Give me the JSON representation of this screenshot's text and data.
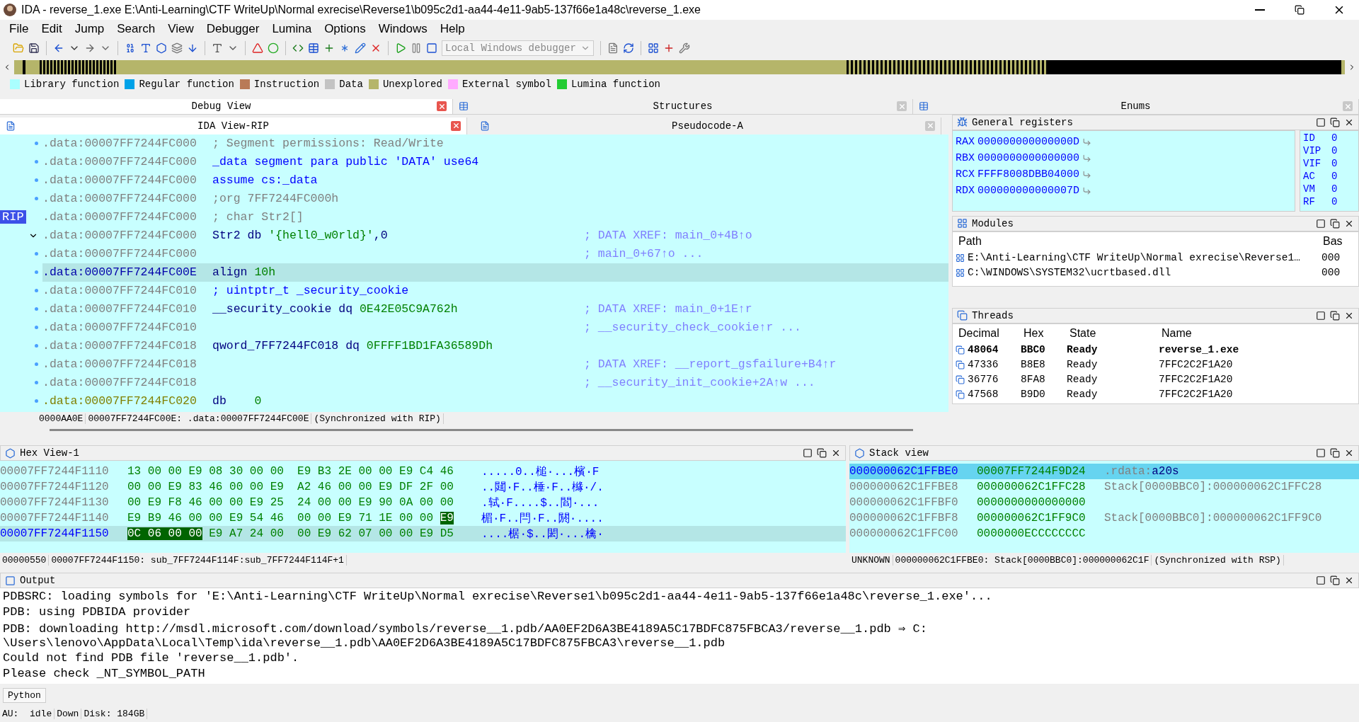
{
  "window": {
    "title": "IDA - reverse_1.exe E:\\Anti-Learning\\CTF WriteUp\\Normal exrecise\\Reverse1\\b095c2d1-aa44-4e11-9ab5-137f66e1a48c\\reverse_1.exe"
  },
  "menu": [
    "File",
    "Edit",
    "Jump",
    "Search",
    "View",
    "Debugger",
    "Lumina",
    "Options",
    "Windows",
    "Help"
  ],
  "toolbar": {
    "debugger": "Local Windows debugger",
    "debugger_disabled": true
  },
  "legend": [
    {
      "label": "Library function",
      "color": "#aaffff"
    },
    {
      "label": "Regular function",
      "color": "#00a2e8"
    },
    {
      "label": "Instruction",
      "color": "#b97a57"
    },
    {
      "label": "Data",
      "color": "#c3c3c3"
    },
    {
      "label": "Unexplored",
      "color": "#b5b56a"
    },
    {
      "label": "External symbol",
      "color": "#ffaaff"
    },
    {
      "label": "Lumina function",
      "color": "#22cc33"
    }
  ],
  "top_tabs": [
    {
      "label": "Debug View",
      "selected": true
    },
    {
      "label": "Structures",
      "selected": false
    },
    {
      "label": "Enums",
      "selected": false
    }
  ],
  "view_tabs": [
    {
      "label": "IDA View-RIP",
      "selected": true
    },
    {
      "label": "Pseudocode-A",
      "selected": false
    }
  ],
  "disasm": {
    "lines": [
      {
        "addr": ".data:00007FF7244FC000",
        "kind": "data",
        "selected": false,
        "tokens": [
          {
            "kind": "grey",
            "text": "; Segment permissions: Read/Write"
          }
        ]
      },
      {
        "addr": ".data:00007FF7244FC000",
        "kind": "data",
        "selected": false,
        "tokens": [
          {
            "kind": "keyword",
            "text": "_data segment para public 'DATA' use64"
          }
        ]
      },
      {
        "addr": ".data:00007FF7244FC000",
        "kind": "data",
        "selected": false,
        "tokens": [
          {
            "kind": "keyword",
            "text": "assume cs:_data"
          }
        ]
      },
      {
        "addr": ".data:00007FF7244FC000",
        "kind": "data",
        "selected": false,
        "tokens": [
          {
            "kind": "grey",
            "text": ";org 7FF7244FC000h"
          }
        ]
      },
      {
        "addr": ".data:00007FF7244FC000",
        "kind": "data",
        "selected": false,
        "marker": "RIP",
        "tokens": [
          {
            "kind": "grey",
            "text": "; char Str2[]"
          }
        ]
      },
      {
        "addr": ".data:00007FF7244FC000",
        "kind": "data",
        "selected": false,
        "expanded": true,
        "tokens": [
          {
            "kind": "name",
            "text": "Str2 db "
          },
          {
            "kind": "number",
            "text": "'{hell0_w0rld}'"
          },
          {
            "kind": "name",
            "text": ",0"
          }
        ],
        "comment": "; DATA XREF: main_0+4B↑o"
      },
      {
        "addr": ".data:00007FF7244FC000",
        "kind": "data",
        "selected": false,
        "comment": "; main_0+67↑o ..."
      },
      {
        "addr": ".data:00007FF7244FC00E",
        "kind": "data",
        "selected": true,
        "tokens": [
          {
            "kind": "name",
            "text": "align "
          },
          {
            "kind": "number",
            "text": "10h"
          }
        ]
      },
      {
        "addr": ".data:00007FF7244FC010",
        "kind": "data",
        "selected": false,
        "tokens": [
          {
            "kind": "keyword",
            "text": "; uintptr_t _security_cookie"
          }
        ]
      },
      {
        "addr": ".data:00007FF7244FC010",
        "kind": "data",
        "selected": false,
        "tokens": [
          {
            "kind": "name",
            "text": "__security_cookie dq "
          },
          {
            "kind": "number",
            "text": "0E42E05C9A762h"
          }
        ],
        "comment": "; DATA XREF: main_0+1E↑r"
      },
      {
        "addr": ".data:00007FF7244FC010",
        "kind": "data",
        "selected": false,
        "comment": "; __security_check_cookie↑r ..."
      },
      {
        "addr": ".data:00007FF7244FC018",
        "kind": "data",
        "selected": false,
        "tokens": [
          {
            "kind": "name",
            "text": "qword_7FF7244FC018 dq "
          },
          {
            "kind": "number",
            "text": "0FFFF1BD1FA36589Dh"
          }
        ]
      },
      {
        "addr": ".data:00007FF7244FC018",
        "kind": "data",
        "selected": false,
        "comment": "; DATA XREF: __report_gsfailure+B4↑r"
      },
      {
        "addr": ".data:00007FF7244FC018",
        "kind": "data",
        "selected": false,
        "comment": "; __security_init_cookie+2A↑w ..."
      },
      {
        "addr": ".data:00007FF7244FC020",
        "kind": "unexplored",
        "selected": false,
        "tokens": [
          {
            "kind": "name",
            "text": "db    "
          },
          {
            "kind": "number",
            "text": "0"
          }
        ]
      }
    ],
    "status": [
      "0000AA0E",
      "00007FF7244FC00E: .data:00007FF7244FC00E",
      "(Synchronized with RIP)"
    ]
  },
  "registers": {
    "title": "General registers",
    "rows": [
      {
        "name": "RAX",
        "value": "000000000000000D"
      },
      {
        "name": "RBX",
        "value": "0000000000000000"
      },
      {
        "name": "RCX",
        "value": "FFFF8008DBB04000"
      },
      {
        "name": "RDX",
        "value": "000000000000007D"
      }
    ],
    "flags": [
      {
        "name": "ID",
        "value": "0"
      },
      {
        "name": "VIP",
        "value": "0"
      },
      {
        "name": "VIF",
        "value": "0"
      },
      {
        "name": "AC",
        "value": "0"
      },
      {
        "name": "VM",
        "value": "0"
      },
      {
        "name": "RF",
        "value": "0"
      }
    ]
  },
  "modules": {
    "title": "Modules",
    "columns": [
      "Path",
      "Bas"
    ],
    "rows": [
      {
        "path": "E:\\Anti-Learning\\CTF WriteUp\\Normal exrecise\\Reverse1…",
        "base": "000"
      },
      {
        "path": "C:\\WINDOWS\\SYSTEM32\\ucrtbased.dll",
        "base": "000"
      }
    ]
  },
  "threads": {
    "title": "Threads",
    "columns": [
      "Decimal",
      "Hex",
      "State",
      "Name"
    ],
    "rows": [
      {
        "decimal": "48064",
        "hex": "BBC0",
        "state": "Ready",
        "name": "reverse_1.exe",
        "selected": true
      },
      {
        "decimal": "47336",
        "hex": "B8E8",
        "state": "Ready",
        "name": "7FFC2C2F1A20",
        "selected": false
      },
      {
        "decimal": "36776",
        "hex": "8FA8",
        "state": "Ready",
        "name": "7FFC2C2F1A20",
        "selected": false
      },
      {
        "decimal": "47568",
        "hex": "B9D0",
        "state": "Ready",
        "name": "7FFC2C2F1A20",
        "selected": false
      }
    ]
  },
  "hex_view": {
    "title": "Hex View-1",
    "rows": [
      {
        "addr": "00007FF7244F1110",
        "selected": false,
        "segments": [
          {
            "text": "13 00 00 E9 08 30 00 00  E9 B3 2E 00 00 E9 C4 46",
            "marked": false
          }
        ],
        "ascii": ".....0..槌·...檳·F"
      },
      {
        "addr": "00007FF7244F1120",
        "selected": false,
        "segments": [
          {
            "text": "00 00 E9 83 46 00 00 E9  A2 46 00 00 E9 DF 2F 00",
            "marked": false
          }
        ],
        "ascii": "..閮·F..棰·F..櫞·/."
      },
      {
        "addr": "00007FF7244F1130",
        "selected": false,
        "segments": [
          {
            "text": "00 E9 F8 46 00 00 E9 25  24 00 00 E9 90 0A 00 00",
            "marked": false
          }
        ],
        "ascii": ".轼·F....$..閻·..."
      },
      {
        "addr": "00007FF7244F1140",
        "selected": false,
        "segments": [
          {
            "text": "E9 B9 46 00 00 E9 54 46  00 00 E9 71 1E 00 00 ",
            "marked": false
          },
          {
            "text": "E9",
            "marked": true
          }
        ],
        "ascii": "楣·F..閂·F..閼·...."
      },
      {
        "addr": "00007FF7244F1150",
        "selected": true,
        "segments": [
          {
            "text": "0C 06 00 00",
            "marked": true
          },
          {
            "text": " E9 A7 24 00  00 E9 62 07 00 00 E9 D5",
            "marked": false
          }
        ],
        "ascii": "....椐·$..閎·...檎·"
      }
    ],
    "status": [
      "00000550",
      "00007FF7244F1150: sub_7FF7244F114F:sub_7FF7244F114F+1"
    ]
  },
  "stack_view": {
    "title": "Stack view",
    "rows": [
      {
        "addr": "000000062C1FFBE0",
        "value": "00007FF7244F9D24",
        "selected": true,
        "tokens": [
          {
            "kind": "grey",
            "text": ".rdata:"
          },
          {
            "kind": "name",
            "text": "a20s"
          }
        ]
      },
      {
        "addr": "000000062C1FFBE8",
        "value": "000000062C1FFC28",
        "selected": false,
        "tokens": [
          {
            "kind": "grey",
            "text": "Stack[0000BBC0]:000000062C1FFC28"
          }
        ]
      },
      {
        "addr": "000000062C1FFBF0",
        "value": "0000000000000000",
        "selected": false
      },
      {
        "addr": "000000062C1FFBF8",
        "value": "000000062C1FF9C0",
        "selected": false,
        "tokens": [
          {
            "kind": "grey",
            "text": "Stack[0000BBC0]:000000062C1FF9C0"
          }
        ]
      },
      {
        "addr": "000000062C1FFC00",
        "value": "0000000ECCCCCCCC",
        "selected": false
      }
    ],
    "status": [
      "UNKNOWN",
      "000000062C1FFBE0: Stack[0000BBC0]:000000062C1F",
      "(Synchronized with RSP)"
    ]
  },
  "output": {
    "title": "Output",
    "lines": [
      "PDBSRC: loading symbols for 'E:\\Anti-Learning\\CTF WriteUp\\Normal exrecise\\Reverse1\\b095c2d1-aa44-4e11-9ab5-137f66e1a48c\\reverse_1.exe'...",
      "PDB: using PDBIDA provider",
      "PDB: downloading http://msdl.microsoft.com/download/symbols/reverse__1.pdb/AA0EF2D6A3BE4189A5C17BDFC875FBCA3/reverse__1.pdb ⇒ C:",
      "\\Users\\lenovo\\AppData\\Local\\Temp\\ida\\reverse__1.pdb\\AA0EF2D6A3BE4189A5C17BDFC875FBCA3\\reverse__1.pdb",
      "Could not find PDB file 'reverse__1.pdb'.",
      "Please check _NT_SYMBOL_PATH"
    ],
    "language": "Python"
  },
  "status_bar": [
    "AU:  idle",
    "Down",
    "Disk: 184GB"
  ]
}
